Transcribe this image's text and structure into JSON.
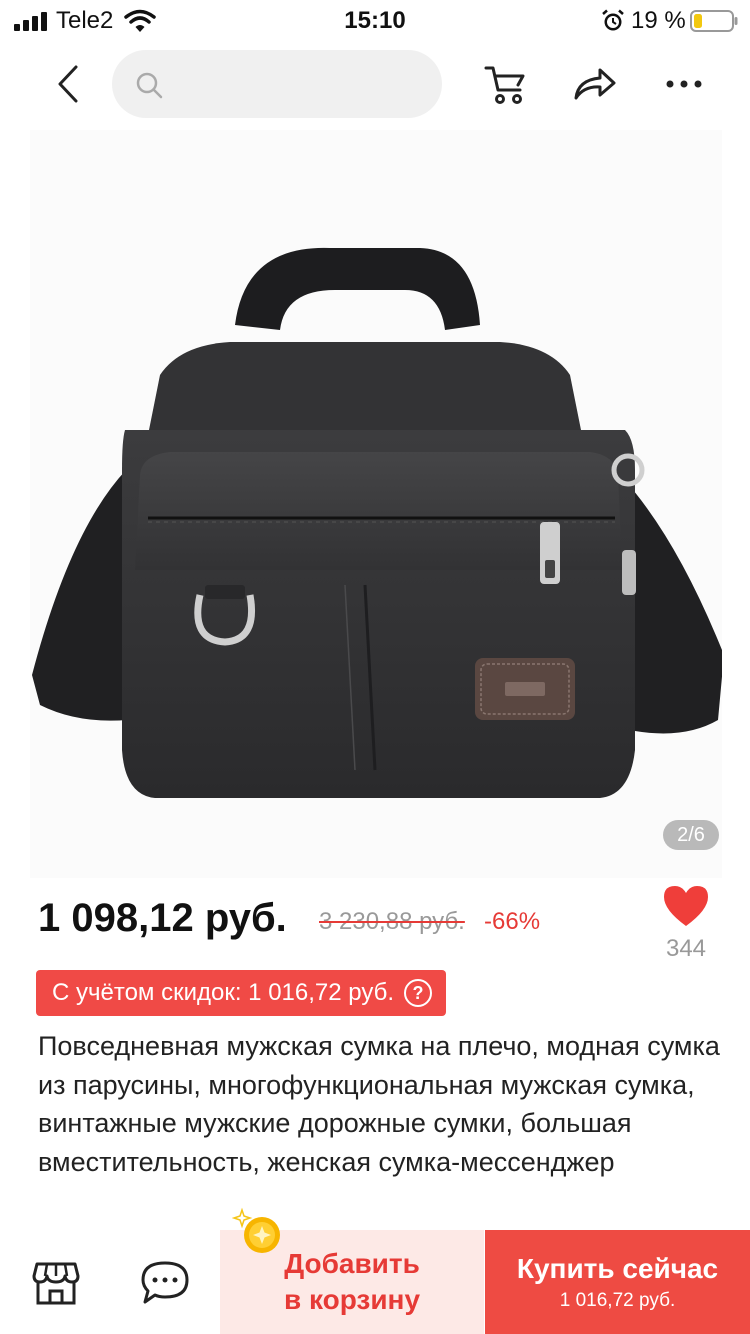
{
  "status_bar": {
    "carrier": "Tele2",
    "time": "15:10",
    "battery_percent": "19 %"
  },
  "nav": {
    "search_placeholder": ""
  },
  "gallery": {
    "counter": "2/6"
  },
  "product": {
    "price": "1 098,12 руб.",
    "old_price": "3 230,88 руб.",
    "discount": "-66%",
    "wishlist_count": "344",
    "coupon_text": "С учётом скидок: 1 016,72 руб.",
    "title": "Повседневная мужская сумка на плечо, модная сумка из парусины, многофункциональная мужская сумка, винтажные мужские дорожные сумки, большая вместительность, женская сумка-мессенджер"
  },
  "bottom_bar": {
    "add_to_cart_label": "Добавить в корзину",
    "buy_now_label": "Купить сейчас",
    "buy_now_price": "1 016,72 руб."
  },
  "colors": {
    "accent_red": "#e63a36",
    "buy_button": "#ee4b43",
    "add_cart_bg": "#fde9e6",
    "coupon_bg": "#f04a46"
  },
  "icons": [
    "signal-icon",
    "wifi-icon",
    "alarm-icon",
    "battery-icon",
    "back-chevron-icon",
    "search-icon",
    "cart-icon",
    "share-icon",
    "more-icon",
    "heart-icon",
    "help-icon",
    "store-icon",
    "chat-icon",
    "coin-icon"
  ]
}
